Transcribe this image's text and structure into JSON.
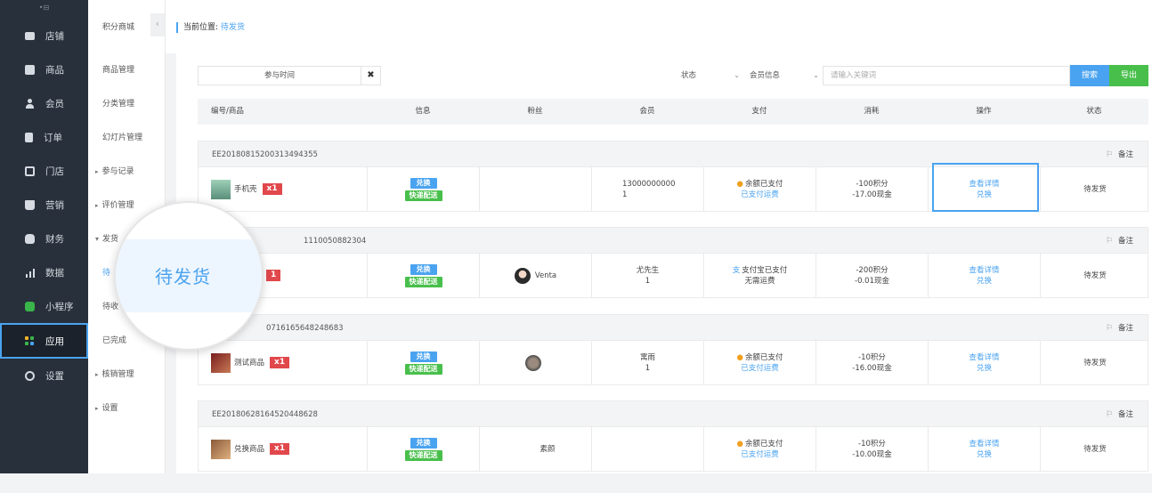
{
  "sidebar": {
    "logo": "•⊟",
    "items": [
      {
        "label": "店铺"
      },
      {
        "label": "商品"
      },
      {
        "label": "会员"
      },
      {
        "label": "订单"
      },
      {
        "label": "门店"
      },
      {
        "label": "营销"
      },
      {
        "label": "财务"
      },
      {
        "label": "数据"
      },
      {
        "label": "小程序"
      },
      {
        "label": "应用"
      },
      {
        "label": "设置"
      }
    ]
  },
  "subnav": {
    "collapse": "‹",
    "items": [
      {
        "label": "积分商城"
      },
      {
        "label": "商品管理"
      },
      {
        "label": "分类管理"
      },
      {
        "label": "幻灯片管理"
      },
      {
        "label": "参与记录"
      },
      {
        "label": "评价管理"
      },
      {
        "label": "发货"
      },
      {
        "label": "待"
      },
      {
        "label": "待收"
      },
      {
        "label": "已完成"
      },
      {
        "label": "核销管理"
      },
      {
        "label": "设置"
      }
    ]
  },
  "breadcrumb": {
    "prefix": "当前位置:",
    "current": "待发货"
  },
  "filters": {
    "date_placeholder": "参与时间",
    "clear": "✖",
    "status_label": "状态",
    "member_label": "会员信息",
    "keyword_placeholder": "请输入关键词",
    "search_btn": "搜索",
    "export_btn": "导出"
  },
  "table": {
    "headers": [
      "编号/商品",
      "信息",
      "粉丝",
      "会员",
      "支付",
      "消耗",
      "操作",
      "状态"
    ],
    "note_label": "备注",
    "orders": [
      {
        "order_no": "EE20180815200313494355",
        "product": "手机壳",
        "qty": "x1",
        "tag1": "兑换",
        "tag2": "快递配送",
        "fan": "",
        "member_line1": "13000000000",
        "member_line2": "1",
        "pay_line1": "余额已支付",
        "pay_line2": "已支付运费",
        "cost_line1": "-100积分",
        "cost_line2": "-17.00现金",
        "action1": "查看详情",
        "action2": "兑换",
        "status": "待发货"
      },
      {
        "order_no": "1110050882304",
        "product": "",
        "qty": "1",
        "tag1": "兑换",
        "tag2": "快递配送",
        "fan": "Venta",
        "member_line1": "尤先生",
        "member_line2": "1",
        "pay_line1": "支付宝已支付",
        "pay_line2": "无需运费",
        "cost_line1": "-200积分",
        "cost_line2": "-0.01现金",
        "action1": "查看详情",
        "action2": "兑换",
        "status": "待发货"
      },
      {
        "order_no": "0716165648248683",
        "product": "测试商品",
        "qty": "x1",
        "tag1": "兑换",
        "tag2": "快递配送",
        "fan": "",
        "member_line1": "寓雨",
        "member_line2": "1",
        "pay_line1": "余额已支付",
        "pay_line2": "已支付运费",
        "cost_line1": "-10积分",
        "cost_line2": "-16.00现金",
        "action1": "查看详情",
        "action2": "兑换",
        "status": "待发货"
      },
      {
        "order_no": "EE20180628164520448628",
        "product": "兑换商品",
        "qty": "x1",
        "tag1": "兑换",
        "tag2": "快递配送",
        "fan": "素颜",
        "member_line1": "",
        "member_line2": "",
        "pay_line1": "余额已支付",
        "pay_line2": "已支付运费",
        "cost_line1": "-10积分",
        "cost_line2": "-10.00现金",
        "action1": "查看详情",
        "action2": "兑换",
        "status": "待发货"
      }
    ]
  },
  "magnifier": {
    "label": "待发货"
  },
  "colors": {
    "accent": "#4aa3f0",
    "export": "#48bf4b",
    "qty": "#e1484c",
    "sidebar": "#28303b"
  }
}
